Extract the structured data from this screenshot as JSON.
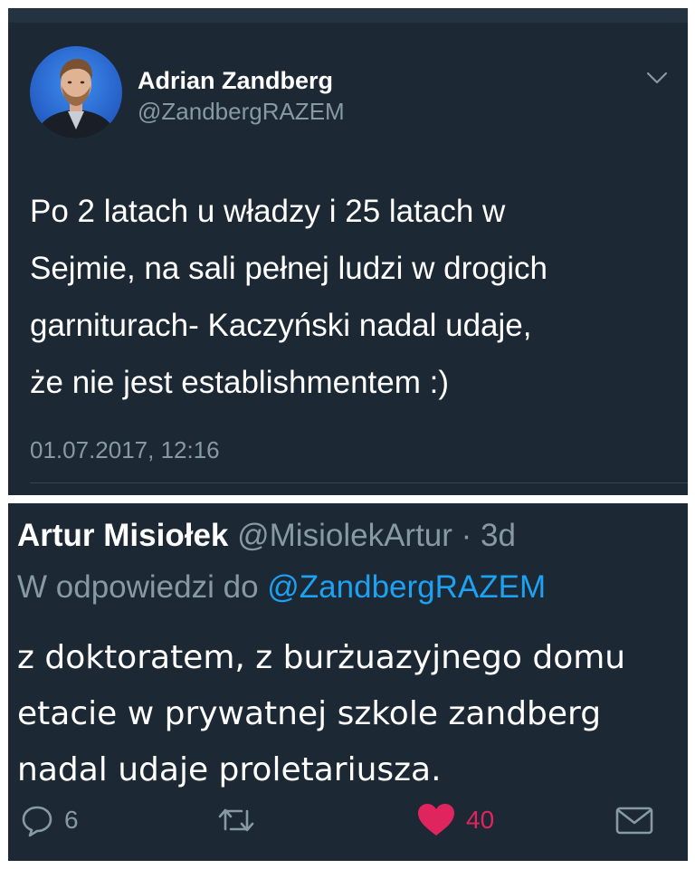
{
  "tweet": {
    "author_name": "Adrian Zandberg",
    "author_handle": "@ZandbergRAZEM",
    "text_lines": [
      "Po 2 latach u władzy i 25 latach w",
      "Sejmie, na sali pełnej ludzi w drogich",
      "garniturach- Kaczyński nadal udaje,",
      "że nie jest establishmentem :)"
    ],
    "timestamp": "01.07.2017, 12:16",
    "menu_icon": "chevron-down-icon",
    "avatar_icon": "avatar"
  },
  "reply": {
    "author_name": "Artur Misiołek",
    "author_handle": "@MisiolekArtur",
    "age": " · 3d",
    "in_reply_prefix": "W odpowiedzi do ",
    "in_reply_mention": "@ZandbergRAZEM",
    "text_lines": [
      "z doktoratem, z burżuazyjnego domu",
      "etacie w prywatnej szkole zandberg",
      "nadal udaje proletariusza."
    ],
    "actions": {
      "reply_count": "6",
      "retweet_count": "",
      "like_count": "40",
      "icons": [
        "reply-icon",
        "retweet-icon",
        "heart-icon",
        "mail-icon"
      ]
    }
  },
  "colors": {
    "background": "#1c2834",
    "text": "#ffffff",
    "muted": "#8899a6",
    "mention": "#1da1f2",
    "like": "#e0245e"
  }
}
